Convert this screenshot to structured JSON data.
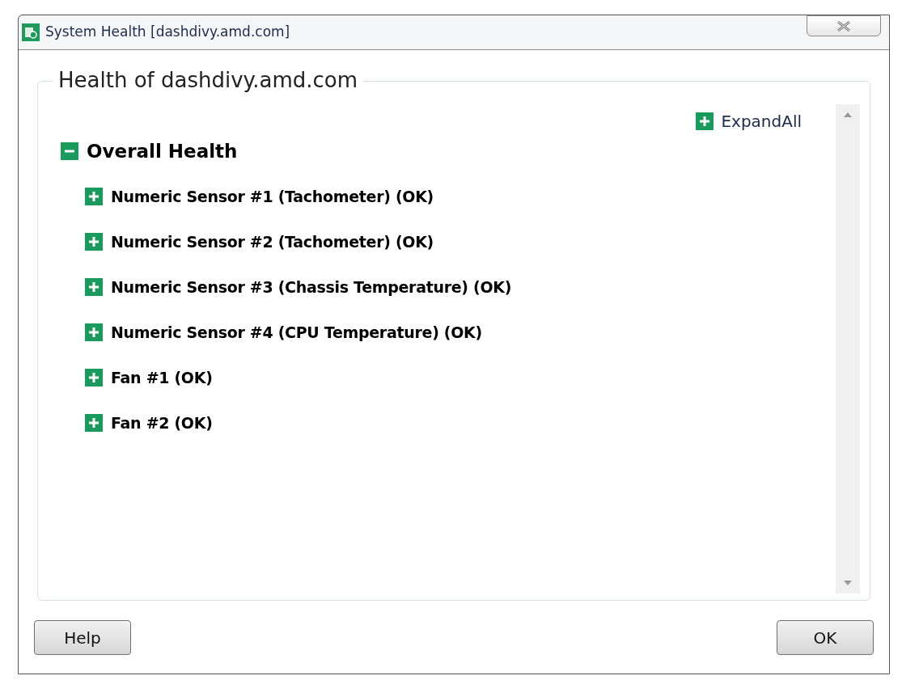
{
  "window": {
    "title": "System Health [dashdivy.amd.com]"
  },
  "group": {
    "title": "Health of dashdivy.amd.com"
  },
  "expand_all": {
    "label": "ExpandAll"
  },
  "tree": [
    {
      "label": "Overall Health",
      "expanded": true,
      "children": [
        {
          "label": "Numeric Sensor #1 (Tachometer) (OK)",
          "expanded": false
        },
        {
          "label": "Numeric Sensor #2 (Tachometer) (OK)",
          "expanded": false
        },
        {
          "label": "Numeric Sensor #3 (Chassis Temperature) (OK)",
          "expanded": false
        },
        {
          "label": "Numeric Sensor #4 (CPU Temperature) (OK)",
          "expanded": false
        },
        {
          "label": "Fan #1 (OK)",
          "expanded": false
        },
        {
          "label": "Fan #2 (OK)",
          "expanded": false
        }
      ]
    }
  ],
  "buttons": [
    {
      "label": "Help"
    },
    {
      "label": "OK"
    }
  ]
}
